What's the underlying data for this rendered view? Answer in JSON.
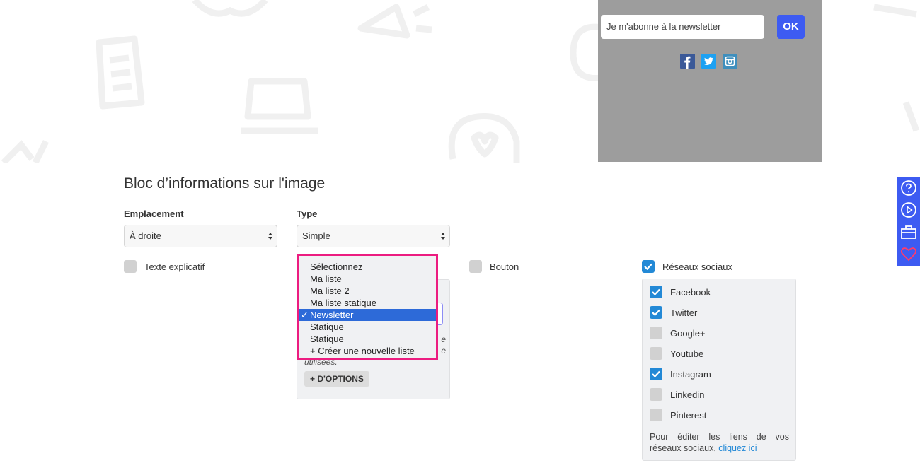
{
  "preview": {
    "newsletter_placeholder": "Je m'abonne à la newsletter",
    "ok_label": "OK",
    "social_icons": [
      "facebook-icon",
      "twitter-icon",
      "instagram-icon"
    ],
    "background_color": "#9d9d9d",
    "button_color": "#3d5bf2"
  },
  "section": {
    "title": "Bloc d’informations sur l'image"
  },
  "emplacement": {
    "label": "Emplacement",
    "value": "À droite"
  },
  "type": {
    "label": "Type",
    "value": "Simple"
  },
  "checkboxes": {
    "texte_explicatif": {
      "label": "Texte explicatif",
      "checked": false
    },
    "bouton": {
      "label": "Bouton",
      "checked": false
    },
    "reseaux_sociaux": {
      "label": "Réseaux sociaux",
      "checked": true
    }
  },
  "list_dropdown": {
    "items": [
      {
        "label": "Sélectionnez",
        "selected": false
      },
      {
        "label": "Ma liste",
        "selected": false
      },
      {
        "label": "Ma liste 2",
        "selected": false
      },
      {
        "label": "Ma liste statique",
        "selected": false
      },
      {
        "label": "Newsletter",
        "selected": true
      },
      {
        "label": "Statique",
        "selected": false
      },
      {
        "label": "Statique",
        "selected": false
      },
      {
        "label": "+ Créer une nouvelle liste",
        "selected": false
      }
    ],
    "tick": "✓",
    "highlight_color": "#ec1c80"
  },
  "type_panel": {
    "hint_line1": "e",
    "hint_line2": "e",
    "hint_line3": "utilisées.",
    "options_label": "+ D'OPTIONS"
  },
  "social_networks": {
    "items": [
      {
        "label": "Facebook",
        "checked": true
      },
      {
        "label": "Twitter",
        "checked": true
      },
      {
        "label": "Google+",
        "checked": false
      },
      {
        "label": "Youtube",
        "checked": false
      },
      {
        "label": "Instagram",
        "checked": true
      },
      {
        "label": "Linkedin",
        "checked": false
      },
      {
        "label": "Pinterest",
        "checked": false
      }
    ],
    "note_text": "Pour éditer les liens de vos réseaux sociaux,",
    "note_link": "cliquez ici"
  },
  "side_toolbar": {
    "icons": [
      "help-icon",
      "play-icon",
      "toolbox-icon",
      "heart-icon"
    ],
    "color": "#3d5bf2"
  }
}
